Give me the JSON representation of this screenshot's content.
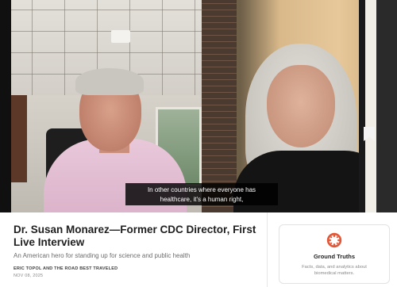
{
  "video": {
    "caption_line1": "In other countries where everyone has",
    "caption_line2": "healthcare, it's a human right,"
  },
  "post": {
    "title": "Dr. Susan Monarez—Former CDC Director, First Live Interview",
    "subtitle": "An American hero for standing up for science and public health",
    "byline": "ERIC TOPOL AND THE ROAD BEST TRAVELED",
    "date": "NOV 08, 2025"
  },
  "publication": {
    "name": "Ground Truths",
    "description": "Facts, data, and analytics about biomedical matters.",
    "logo_icon": "ground-truths-logo-icon",
    "accent_color": "#e0583a"
  }
}
